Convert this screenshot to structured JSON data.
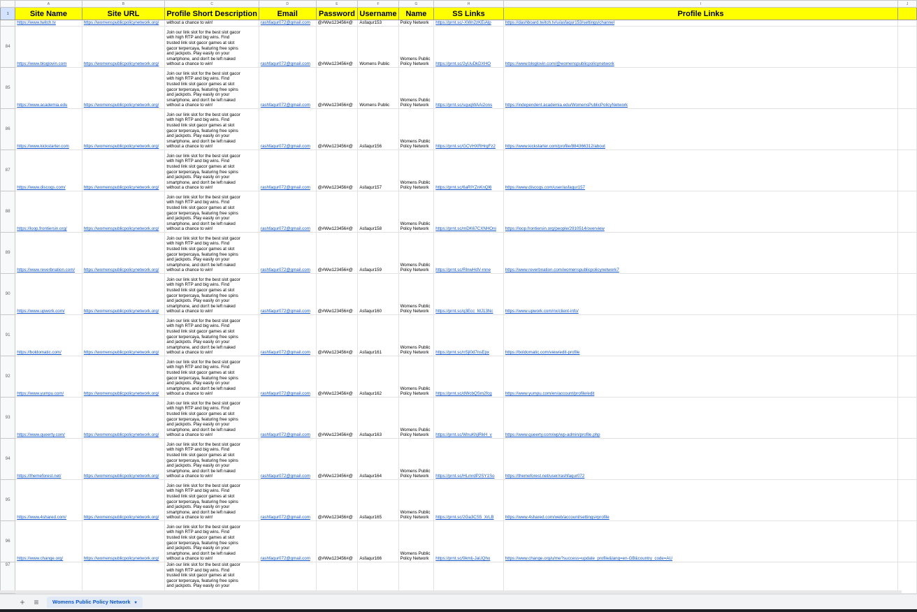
{
  "columns": [
    "A",
    "B",
    "C",
    "D",
    "E",
    "F",
    "G",
    "H",
    "I",
    "J"
  ],
  "header_row_number": "1",
  "headers": [
    "Site Name",
    "Site URL",
    "Profile Short Description",
    "Email",
    "Password",
    "Username",
    "Name",
    "SS Links",
    "Profile Links"
  ],
  "desc_lines": [
    "Join our link slot for the best slot gacor",
    "with high RTP and big wins. Find",
    "trusted link slot gacor games at slot",
    "gacor terpercaya, featuring free spins",
    "and jackpots. Play easily on your",
    "smartphone, and don't be left naked",
    "without a chance to win!"
  ],
  "top_row": {
    "site": "https://www.twitch.tv",
    "url": "https://womenspublicpolicynetwork.org/",
    "desc_last": "without a chance to win!",
    "email": "rashfaqur072@gmail.com",
    "password": "@#Ww123456#@",
    "username": "Asfaqur153",
    "name": "Policy Network",
    "ss": "https://prnt.sc/-XWn2zKEiAlp",
    "profile": "https://dashboard.twitch.tv/u/asfaqur153/settings/channel"
  },
  "rows": [
    {
      "num": "84",
      "site": "https://www.bloglovin.com",
      "url": "https://womenspublicpolicynetwork.org/",
      "email": "rashfaqur072@gmail.com",
      "password": "@#Ww123456#@",
      "username": "Womens Public",
      "name": [
        "Womens Public",
        "Policy Network"
      ],
      "ss": "https://prnt.sc/2yUuDkDXHO",
      "profile": "https://www.bloglovin.com/@womenspublicpolicynetwork"
    },
    {
      "num": "85",
      "site": "https://www.academia.edu",
      "url": "https://womenspublicpolicynetwork.org/",
      "email": "rashfaqur072@gmail.com",
      "password": "@#Ww123456#@",
      "username": "Womens Public",
      "name": [
        "Womens Public",
        "Policy Network"
      ],
      "ss": "https://prnt.sc/squqWAAi2ons",
      "profile": "https://independent.academia.edu/WomensPublicPolicyNetwork"
    },
    {
      "num": "86",
      "site": "https://www.kickstarter.com",
      "url": "https://womenspublicpolicynetwork.org/",
      "email": "rashfaqur072@gmail.com",
      "password": "@#Ww123456#@",
      "username": "Asfaqur156",
      "name": [
        "Womens Public",
        "Policy Network"
      ],
      "ss": "https://prnt.sc/GCVHXRHrgFz2",
      "profile": "https://www.kickstarter.com/profile/884366312/about"
    },
    {
      "num": "87",
      "site": "https://www.discogs.com/",
      "url": "https://womenspublicpolicynetwork.org/",
      "email": "rashfaqur072@gmail.com",
      "password": "@#Ww123456#@",
      "username": "Asfaqur157",
      "name": [
        "Womens Public",
        "Policy Network"
      ],
      "ss": "https://prnt.sc/6aRlYZnKnQl6",
      "profile": "https://www.discogs.com/user/asfaqur157"
    },
    {
      "num": "88",
      "site": "https://loop.frontiersin.org/",
      "url": "https://womenspublicpolicynetwork.org/",
      "email": "rashfaqur072@gmail.com",
      "password": "@#Ww123456#@",
      "username": "Asfaqur158",
      "name": [
        "Womens Public",
        "Policy Network"
      ],
      "ss": "https://prnt.sc/mDK67CXNHOni",
      "profile": "https://loop.frontiersin.org/people/2910514/overview"
    },
    {
      "num": "89",
      "site": "https://www.reverbnation.com/",
      "url": "https://womenspublicpolicynetwork.org/",
      "email": "rashfaqur072@gmail.com",
      "password": "@#Ww123456#@",
      "username": "Asfaqur159",
      "name": [
        "Womens Public",
        "Policy Network"
      ],
      "ss": "https://prnt.sc/RlnwHdV-rnne",
      "profile": "https://www.reverbnation.com/womenspublicpolicynetwork7"
    },
    {
      "num": "90",
      "site": "https://www.upwork.com/",
      "url": "https://womenspublicpolicynetwork.org/",
      "email": "rashfaqur072@gmail.com",
      "password": "@#Ww123456#@",
      "username": "Asfaqur160",
      "name": [
        "Womens Public",
        "Policy Network"
      ],
      "ss": "https://prnt.sc/q3Ecc_MJ13Nc",
      "profile": "https://www.upwork.com/nx/client-info/"
    },
    {
      "num": "91",
      "site": "https://boldomatic.com/",
      "url": "https://womenspublicpolicynetwork.org/",
      "email": "rashfaqur072@gmail.com",
      "password": "@#Ww123456#@",
      "username": "Asfaqur161",
      "name": [
        "Womens Public",
        "Policy Network"
      ],
      "ss": "https://prnt.sc/nSjl0d7nsEpx",
      "profile": "https://boldomatic.com/view/edit-profile"
    },
    {
      "num": "92",
      "site": "https://www.yumpu.com/",
      "url": "https://womenspublicpolicynetwork.org/",
      "email": "rashfaqur072@gmail.com",
      "password": "@#Ww123456#@",
      "username": "Asfaqur162",
      "name": [
        "Womens Public",
        "Policy Network"
      ],
      "ss": "https://prnt.sc/dWcbQSm2fcg",
      "profile": "https://www.yumpu.com/en/account/profile/edit"
    },
    {
      "num": "93",
      "site": "https://www.queerty.com/",
      "url": "https://womenspublicpolicynetwork.org/",
      "email": "rashfaqur072@gmail.com",
      "password": "@#Ww123456#@",
      "username": "Asfaqur163",
      "name": [
        "Womens Public",
        "Policy Network"
      ],
      "ss": "https://prnt.sc/WnuKhjlRkH_v",
      "profile": "https://www.queerty.com/wp/wp-admin/profile.php"
    },
    {
      "num": "94",
      "site": "https://themeforest.net/",
      "url": "https://womenspublicpolicynetwork.org/",
      "email": "rashfaqur072@gmail.com",
      "password": "@#Ww123456#@",
      "username": "Asfaqur164",
      "name": [
        "Womens Public",
        "Policy Network"
      ],
      "ss": "https://prnt.sc/HLmrdP2SY1So",
      "profile": "https://themeforest.net/user/rashfaqur072"
    },
    {
      "num": "95",
      "site": "https://www.4shared.com/",
      "url": "https://womenspublicpolicynetwork.org/",
      "email": "rashfaqur072@gmail.com",
      "password": "@#Ww123456#@",
      "username": "Asfaqur165",
      "name": [
        "Womens Public",
        "Policy Network"
      ],
      "ss": "https://prnt.sc/2Ga3CS5_XrLB",
      "profile": "https://www.4shared.com/web/account/settings#profile"
    },
    {
      "num": "96",
      "site": "https://www.change.org/",
      "url": "https://womenspublicpolicynetwork.org/",
      "email": "rashfaqur072@gmail.com",
      "password": "@#Ww123456#@",
      "username": "Asfaqur166",
      "name": [
        "Womens Public",
        "Policy Network"
      ],
      "ss": "https://prnt.sc/9kmlj-JaUQho",
      "profile": "https://www.change.org/u/me?success=update_profile&lang=en-GB&country_code=AU"
    }
  ],
  "last_row": {
    "num": "97",
    "desc_lines": [
      "Join our link slot for the best slot gacor",
      "with high RTP and big wins. Find",
      "trusted link slot gacor games at slot",
      "gacor terpercaya, featuring free spins",
      "and jackpots. Play easily on your"
    ]
  },
  "tabbar": {
    "add_icon": "+",
    "menu_icon": "≡",
    "sheet_tab": "Womens Public Policy Network",
    "caret": "▾"
  },
  "colors": {
    "header_fill": "#ffff00",
    "link": "#1155cc",
    "tab_text": "#0b57d0"
  }
}
